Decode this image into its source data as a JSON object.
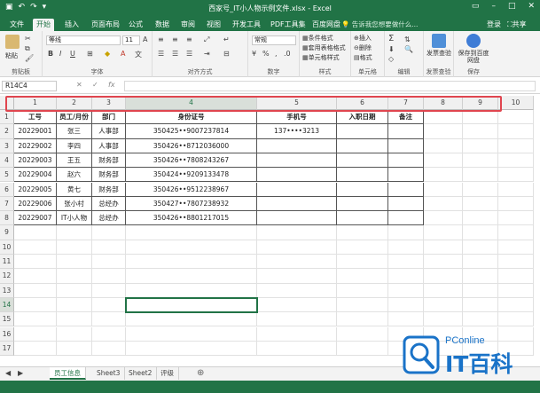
{
  "window": {
    "title": "西家号_IT小人物示例文件.xlsx - Excel"
  },
  "ribbon_tabs": [
    "文件",
    "开始",
    "插入",
    "页面布局",
    "公式",
    "数据",
    "审阅",
    "视图",
    "开发工具",
    "PDF工具集",
    "百度网盘"
  ],
  "active_tab": "开始",
  "tell_me": "告诉我您想要做什么...",
  "account": {
    "login": "登录",
    "share": "共享"
  },
  "ribbon": {
    "clipboard": {
      "label": "剪贴板",
      "paste": "粘贴"
    },
    "font": {
      "label": "字体",
      "font_name": "等线",
      "font_size": "11",
      "bold": "B",
      "italic": "I",
      "underline": "U"
    },
    "alignment": {
      "label": "对齐方式"
    },
    "number": {
      "label": "数字",
      "format": "常规"
    },
    "styles": {
      "label": "样式",
      "conditional": "条件格式",
      "as_table": "套用表格格式",
      "cell_styles": "单元格样式"
    },
    "cells": {
      "label": "单元格",
      "insert": "插入",
      "delete": "删除",
      "format": "格式"
    },
    "editing": {
      "label": "编辑"
    },
    "invoice": {
      "label": "发票查验",
      "btn": "发票查验"
    },
    "baidu": {
      "label": "保存",
      "btn": "保存到百度网盘"
    }
  },
  "formula_bar": {
    "name_box": "R14C4",
    "fx": "fx",
    "value": ""
  },
  "columns": [
    "1",
    "2",
    "3",
    "4",
    "5",
    "6",
    "7",
    "8",
    "9",
    "10"
  ],
  "rows": [
    "1",
    "2",
    "3",
    "4",
    "5",
    "6",
    "7",
    "8",
    "9",
    "10",
    "11",
    "12",
    "13",
    "14",
    "15",
    "16",
    "17"
  ],
  "table": {
    "headers": [
      "工号",
      "员工/月份",
      "部门",
      "身份证号",
      "手机号",
      "入职日期",
      "备注"
    ],
    "rows": [
      [
        "20229001",
        "张三",
        "人事部",
        "350425••9007237814",
        "137••••3213",
        "",
        ""
      ],
      [
        "20229002",
        "李四",
        "人事部",
        "350426••8712036000",
        "",
        "",
        ""
      ],
      [
        "20229003",
        "王五",
        "财务部",
        "350426••7808243267",
        "",
        "",
        ""
      ],
      [
        "20229004",
        "赵六",
        "财务部",
        "350424••9209133478",
        "",
        "",
        ""
      ],
      [
        "20229005",
        "黄七",
        "财务部",
        "350426••9512238967",
        "",
        "",
        ""
      ],
      [
        "20229006",
        "张小村",
        "总经办",
        "350427••7807238932",
        "",
        "",
        ""
      ],
      [
        "20229007",
        "IT小人物",
        "总经办",
        "350426••8801217015",
        "",
        "",
        ""
      ]
    ]
  },
  "sheets": [
    "员工信息",
    "Sheet3",
    "Sheet2",
    "评级"
  ],
  "active_sheet": "员工信息",
  "watermark": {
    "brand": "PConline",
    "text": "IT百科"
  },
  "colors": {
    "excel_green": "#217346",
    "highlight_red": "#e0454f"
  }
}
